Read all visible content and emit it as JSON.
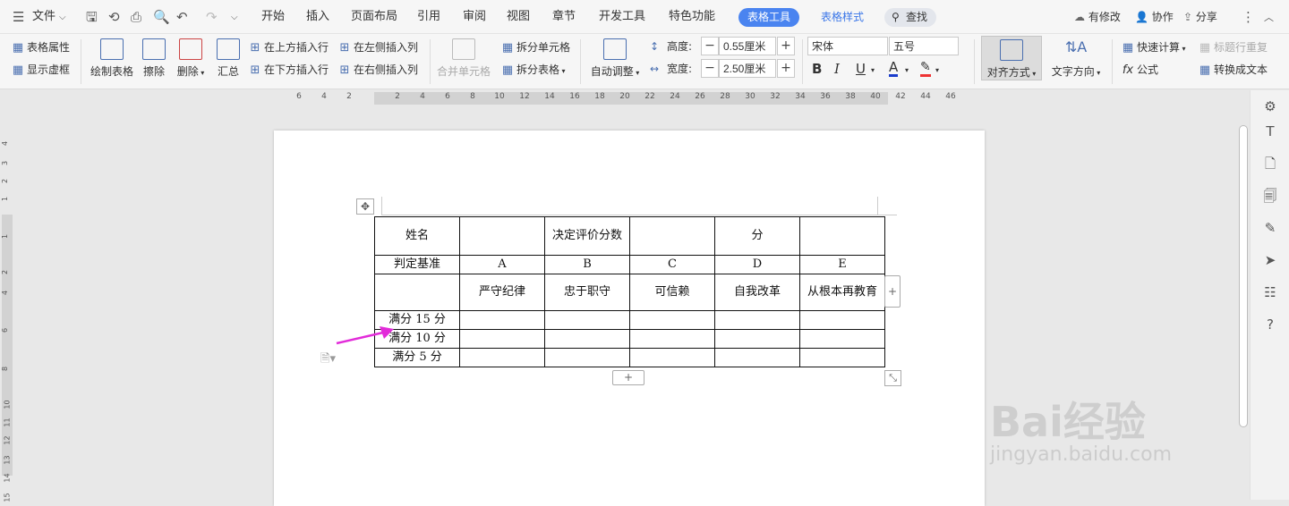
{
  "menubar": {
    "file": "文件",
    "tabs": [
      "开始",
      "插入",
      "页面布局",
      "引用",
      "审阅",
      "视图",
      "章节",
      "开发工具",
      "特色功能"
    ],
    "table_tools": "表格工具",
    "table_style": "表格样式",
    "find": "查找",
    "has_changes": "有修改",
    "collaborate": "协作",
    "share": "分享"
  },
  "ribbon": {
    "table_props": "表格属性",
    "show_gridlines": "显示虚框",
    "draw_table": "绘制表格",
    "erase": "擦除",
    "delete": "删除",
    "summary": "汇总",
    "insert_row_above": "在上方插入行",
    "insert_row_below": "在下方插入行",
    "insert_col_left": "在左侧插入列",
    "insert_col_right": "在右侧插入列",
    "merge_cells": "合并单元格",
    "split_cells": "拆分单元格",
    "split_table": "拆分表格",
    "auto_adjust": "自动调整",
    "height_label": "高度:",
    "height_value": "0.55厘米",
    "width_label": "宽度:",
    "width_value": "2.50厘米",
    "font_name": "宋体",
    "font_size": "五号",
    "align": "对齐方式",
    "text_direction": "文字方向",
    "quick_calc": "快速计算",
    "repeat_header": "标题行重复",
    "formula": "公式",
    "to_text": "转换成文本"
  },
  "ruler": {
    "h_ticks": [
      "6",
      "4",
      "2",
      "2",
      "4",
      "6",
      "8",
      "10",
      "12",
      "14",
      "16",
      "18",
      "20",
      "22",
      "24",
      "26",
      "28",
      "30",
      "32",
      "34",
      "36",
      "38",
      "40",
      "42",
      "44",
      "46"
    ],
    "v_ticks": [
      "4",
      "3",
      "2",
      "1",
      "1",
      "2",
      "4",
      "6",
      "8",
      "10",
      "11",
      "12",
      "13",
      "14",
      "15"
    ]
  },
  "table": {
    "rows": [
      [
        "姓名",
        "",
        "决定评价分数",
        "",
        "分",
        ""
      ],
      [
        "判定基准",
        "A",
        "B",
        "C",
        "D",
        "E"
      ],
      [
        "",
        "严守纪律",
        "忠于职守",
        "可信赖",
        "自我改革",
        "从根本再教育"
      ],
      [
        "满分 15 分",
        "",
        "",
        "",
        "",
        ""
      ],
      [
        "满分 10 分",
        "",
        "",
        "",
        "",
        ""
      ],
      [
        "满分 5 分",
        "",
        "",
        "",
        "",
        ""
      ]
    ]
  },
  "watermark": {
    "brand": "Bai经验",
    "url": "jingyan.baidu.com"
  },
  "colors": {
    "accent": "#4a84f0",
    "arrow": "#e22bd9"
  }
}
